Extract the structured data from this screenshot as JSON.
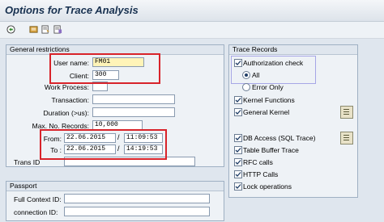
{
  "window": {
    "title": "Options for Trace Analysis"
  },
  "toolbar": {
    "icons": [
      "execute-icon",
      "save-variant-icon",
      "get-variant-icon",
      "variant-attributes-icon"
    ]
  },
  "general": {
    "title": "General restrictions",
    "user_name_label": "User name:",
    "user_name_value": "FM01",
    "client_label": "Client:",
    "client_value": "300",
    "work_process_label": "Work Process:",
    "work_process_value": "",
    "transaction_label": "Transaction:",
    "transaction_value": "",
    "duration_label": "Duration (>us):",
    "duration_value": "",
    "max_records_label": "Max. No. Records:",
    "max_records_value": "10,000",
    "from_label": "From:",
    "from_date": "22.06.2015",
    "from_time": "11:09:53",
    "to_label": "To :",
    "to_date": "22.06.2015",
    "to_time": "14:19:53",
    "slash": "/",
    "trans_id_label": "Trans ID",
    "trans_id_value": ""
  },
  "passport": {
    "title": "Passport",
    "full_context_label": "Full Context ID:",
    "full_context_value": "",
    "connection_label": "connection ID:",
    "connection_value": ""
  },
  "trace_records": {
    "title": "Trace Records",
    "authorization_check": {
      "label": "Authorization check",
      "checked": true
    },
    "auth_all": {
      "label": "All",
      "selected": true
    },
    "auth_error_only": {
      "label": "Error Only",
      "selected": false
    },
    "kernel_functions": {
      "label": "Kernel Functions",
      "checked": true
    },
    "general_kernel": {
      "label": "General Kernel",
      "checked": true
    },
    "db_access": {
      "label": "DB Access (SQL Trace)",
      "checked": true
    },
    "table_buffer": {
      "label": "Table Buffer Trace",
      "checked": true
    },
    "rfc_calls": {
      "label": "RFC calls",
      "checked": true
    },
    "http_calls": {
      "label": "HTTP Calls",
      "checked": true
    },
    "lock_operations": {
      "label": "Lock operations",
      "checked": true
    }
  }
}
